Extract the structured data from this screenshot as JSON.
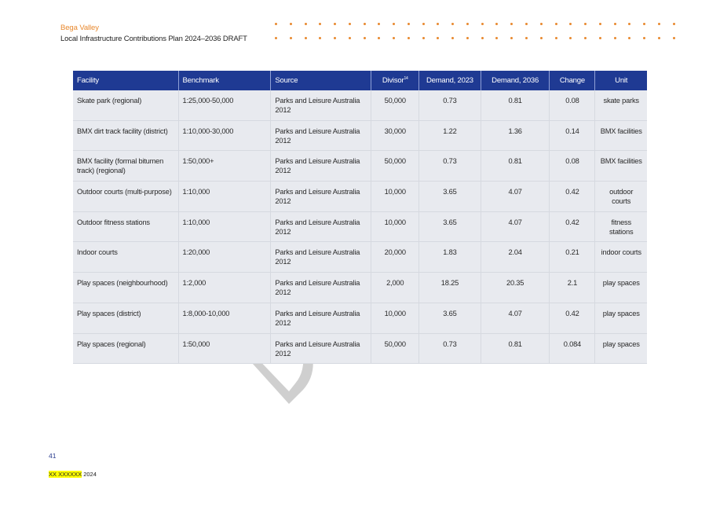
{
  "header": {
    "title": "Bega Valley",
    "subtitle": "Local Infrastructure Contributions Plan 2024–2036 DRAFT"
  },
  "table": {
    "columns": [
      {
        "label": "Facility",
        "sup": ""
      },
      {
        "label": "Benchmark",
        "sup": ""
      },
      {
        "label": "Source",
        "sup": ""
      },
      {
        "label": "Divisor",
        "sup": "14"
      },
      {
        "label": "Demand, 2023",
        "sup": ""
      },
      {
        "label": "Demand, 2036",
        "sup": ""
      },
      {
        "label": "Change",
        "sup": ""
      },
      {
        "label": "Unit",
        "sup": ""
      }
    ],
    "rows": [
      [
        "Skate park (regional)",
        "1:25,000-50,000",
        "Parks and Leisure Australia 2012",
        "50,000",
        "0.73",
        "0.81",
        "0.08",
        "skate parks"
      ],
      [
        "BMX dirt track facility (district)",
        "1:10,000-30,000",
        "Parks and Leisure Australia 2012",
        "30,000",
        "1.22",
        "1.36",
        "0.14",
        "BMX facilities"
      ],
      [
        "BMX facility (formal bitumen track) (regional)",
        "1:50,000+",
        "Parks and Leisure Australia 2012",
        "50,000",
        "0.73",
        "0.81",
        "0.08",
        "BMX facilities"
      ],
      [
        "Outdoor courts (multi-purpose)",
        "1:10,000",
        "Parks and Leisure Australia 2012",
        "10,000",
        "3.65",
        "4.07",
        "0.42",
        "outdoor courts"
      ],
      [
        "Outdoor fitness stations",
        "1:10,000",
        "Parks and Leisure Australia 2012",
        "10,000",
        "3.65",
        "4.07",
        "0.42",
        "fitness stations"
      ],
      [
        "Indoor courts",
        "1:20,000",
        "Parks and Leisure Australia 2012",
        "20,000",
        "1.83",
        "2.04",
        "0.21",
        "indoor courts"
      ],
      [
        "Play  spaces (neighbourhood)",
        "1:2,000",
        "Parks and Leisure Australia 2012",
        "2,000",
        "18.25",
        "20.35",
        "2.1",
        "play spaces"
      ],
      [
        "Play  spaces (district)",
        "1:8,000-10,000",
        "Parks and Leisure Australia 2012",
        "10,000",
        "3.65",
        "4.07",
        "0.42",
        "play spaces"
      ],
      [
        "Play  spaces (regional)",
        "1:50,000",
        "Parks and Leisure Australia 2012",
        "50,000",
        "0.73",
        "0.81",
        "0.084",
        "play spaces"
      ]
    ]
  },
  "footer": {
    "page_number": "41",
    "date_placeholder": "XX XXXXXX",
    "year": " 2024"
  },
  "colors": {
    "accent_orange": "#e8892f",
    "header_blue": "#1f3a93",
    "row_bg": "#e8eaef",
    "highlight": "#ffff00"
  }
}
